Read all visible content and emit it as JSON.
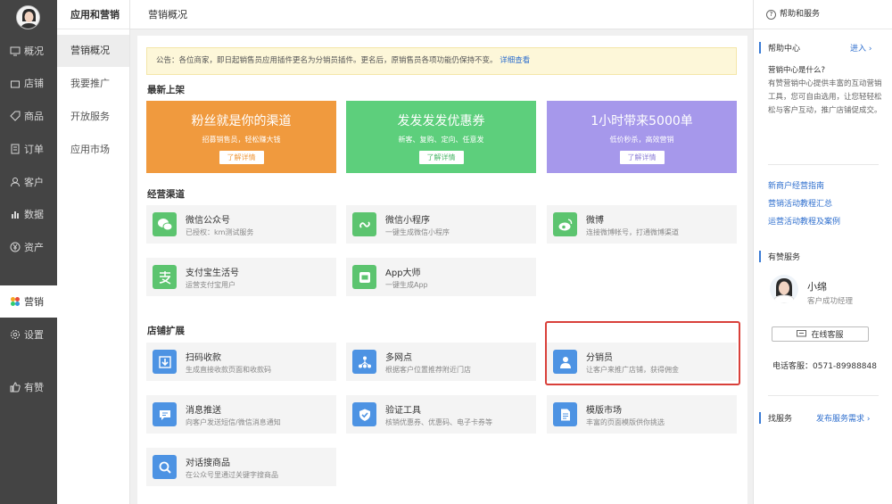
{
  "nav": {
    "items": [
      "概况",
      "店铺",
      "商品",
      "订单",
      "客户",
      "数据",
      "资产",
      "营销",
      "设置",
      "有赞"
    ]
  },
  "subnav": {
    "title": "应用和营销",
    "items": [
      "营销概况",
      "我要推广",
      "开放服务",
      "应用市场"
    ]
  },
  "topbar": {
    "title": "营销概况"
  },
  "notice": {
    "text": "公告：各位商家，即日起销售员应用插件更名为分销员插件。更名后，原销售员各项功能仍保持不变。",
    "link": "详细查看"
  },
  "sections": {
    "latest": "最新上架",
    "channels": "经营渠道",
    "expand": "店铺扩展"
  },
  "banners": [
    {
      "title": "粉丝就是你的渠道",
      "sub": "招募销售员，轻松赚大钱",
      "btn": "了解详情",
      "color": "#f09a3e",
      "btn_color": "#f09a3e"
    },
    {
      "title": "发发发发优惠券",
      "sub": "新客、复购、定向、任意发",
      "btn": "了解详情",
      "color": "#5dcf7c",
      "btn_color": "#4cb86a"
    },
    {
      "title": "1小时带来5000单",
      "sub": "低价秒杀，高效营销",
      "btn": "了解详情",
      "color": "#a698eb",
      "btn_color": "#8e80d8"
    }
  ],
  "channels": [
    {
      "name": "微信公众号",
      "desc": "已授权：km测试服务",
      "icon": "wechat-icon",
      "color": "#5cc46f"
    },
    {
      "name": "微信小程序",
      "desc": "一键生成微信小程序",
      "icon": "mini-program-icon",
      "color": "#5cc46f"
    },
    {
      "name": "微博",
      "desc": "连接微博帐号，打通微博渠道",
      "icon": "weibo-icon",
      "color": "#5cc46f"
    },
    {
      "name": "支付宝生活号",
      "desc": "运营支付宝用户",
      "icon": "alipay-icon",
      "color": "#5cc46f"
    },
    {
      "name": "App大师",
      "desc": "一键生成App",
      "icon": "app-icon",
      "color": "#5cc46f"
    }
  ],
  "expand": [
    {
      "name": "扫码收款",
      "desc": "生成直接收款页面和收款码",
      "icon": "scan-pay-icon",
      "color": "#4d93e3"
    },
    {
      "name": "多网点",
      "desc": "根据客户位置推荐附近门店",
      "icon": "multi-store-icon",
      "color": "#4d93e3"
    },
    {
      "name": "分销员",
      "desc": "让客户来推广店铺，获得佣金",
      "icon": "distributor-icon",
      "color": "#4d93e3"
    },
    {
      "name": "消息推送",
      "desc": "向客户发送短信/微信消息通知",
      "icon": "message-icon",
      "color": "#4d93e3"
    },
    {
      "name": "验证工具",
      "desc": "核销优惠券、优惠码、电子卡券等",
      "icon": "verify-icon",
      "color": "#4d93e3"
    },
    {
      "name": "模版市场",
      "desc": "丰富的页面模版供你挑选",
      "icon": "template-icon",
      "color": "#4d93e3"
    },
    {
      "name": "对话搜商品",
      "desc": "在公众号里通过关键字搜商品",
      "icon": "search-goods-icon",
      "color": "#4d93e3"
    }
  ],
  "right": {
    "head": "帮助和服务",
    "help_title": "帮助中心",
    "help_enter": "进入 ›",
    "help_q": "营销中心是什么?",
    "help_text": "有赞营销中心提供丰富的互动营销工具，您可自由选用，让您轻轻松松与客户互动，推广店铺促成交。",
    "links": [
      "新商户经营指南",
      "营销活动教程汇总",
      "运营活动教程及案例"
    ],
    "service_title": "有赞服务",
    "person_name": "小绵",
    "person_role": "客户成功经理",
    "online_btn": "在线客服",
    "phone_label": "电话客服：",
    "phone": "0571-89988848",
    "svc2_title": "找服务",
    "svc2_link": "发布服务需求 ›"
  }
}
